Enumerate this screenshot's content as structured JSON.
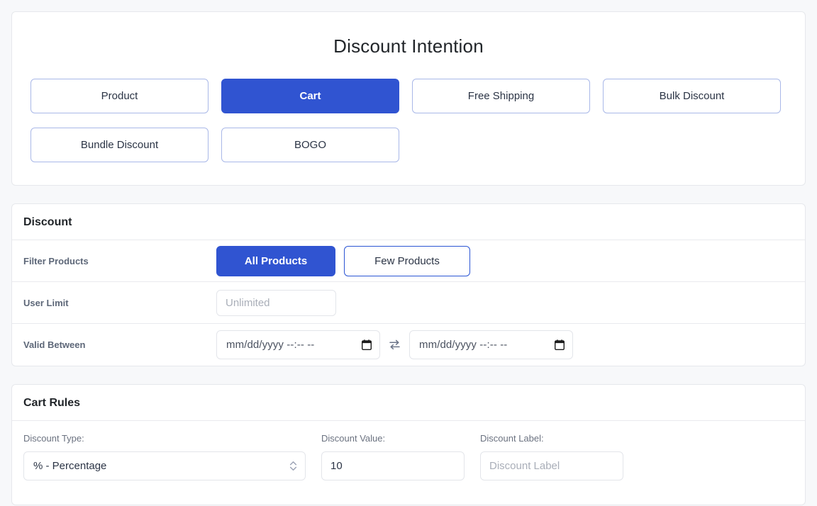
{
  "header": {
    "title": "Discount Intention"
  },
  "intentions": [
    {
      "label": "Product",
      "active": false,
      "name": "intention-product"
    },
    {
      "label": "Cart",
      "active": true,
      "name": "intention-cart"
    },
    {
      "label": "Free Shipping",
      "active": false,
      "name": "intention-free-shipping"
    },
    {
      "label": "Bulk Discount",
      "active": false,
      "name": "intention-bulk-discount"
    },
    {
      "label": "Bundle Discount",
      "active": false,
      "name": "intention-bundle-discount"
    },
    {
      "label": "BOGO",
      "active": false,
      "name": "intention-bogo"
    }
  ],
  "discount": {
    "section_title": "Discount",
    "filter_products": {
      "label": "Filter Products",
      "all_products": "All Products",
      "few_products": "Few Products",
      "selected": "All Products"
    },
    "user_limit": {
      "label": "User Limit",
      "value": "",
      "placeholder": "Unlimited"
    },
    "valid_between": {
      "label": "Valid Between",
      "start_value": "",
      "start_placeholder": "mm/dd/yyyy --:-- --",
      "end_value": "",
      "end_placeholder": "mm/dd/yyyy --:-- --",
      "swap_icon": "swap-horizontal-icon",
      "calendar_icon": "calendar-icon"
    }
  },
  "cart_rules": {
    "section_title": "Cart Rules",
    "discount_type": {
      "label": "Discount Type:",
      "value": "% - Percentage",
      "options": [
        "% - Percentage"
      ]
    },
    "discount_value": {
      "label": "Discount Value:",
      "value": "10",
      "placeholder": ""
    },
    "discount_label": {
      "label": "Discount Label:",
      "value": "",
      "placeholder": "Discount Label"
    }
  },
  "colors": {
    "accent": "#3054d1",
    "accent_border": "#2b55d4",
    "soft_border": "#a9b8e8",
    "page_bg": "#f7f8fa",
    "card_bg": "#ffffff",
    "label_text": "#5d6778"
  }
}
